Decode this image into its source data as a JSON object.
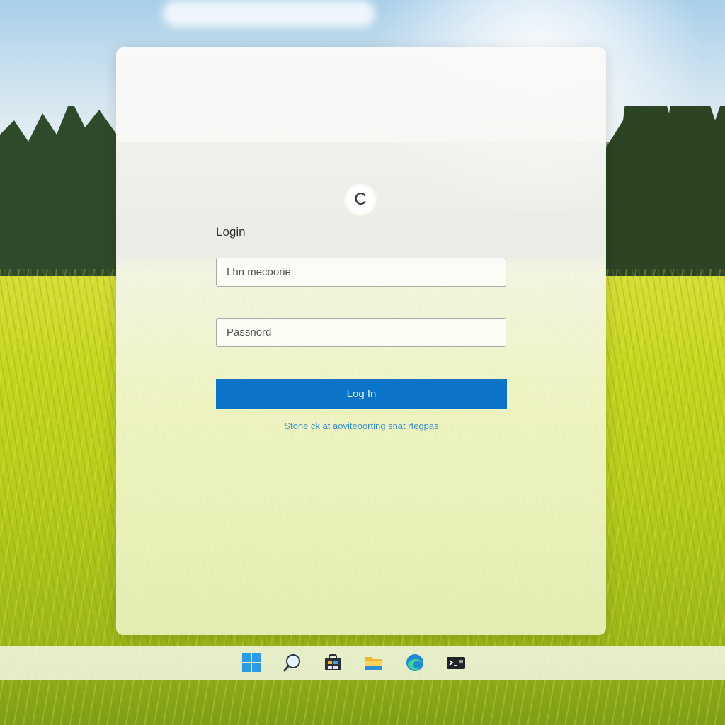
{
  "login_card": {
    "logo_letter": "C",
    "heading": "Login",
    "username_placeholder": "Lhn mecoorie",
    "password_placeholder": "Passnord",
    "login_button_label": "Log In",
    "help_link_text": "Stone ck at aoviteoorting snat rtegpas"
  },
  "taskbar": {
    "icons": [
      "windows-start-icon",
      "search-icon",
      "store-icon",
      "file-explorer-icon",
      "edge-browser-icon",
      "terminal-icon"
    ]
  },
  "colors": {
    "accent": "#0a74c9",
    "link": "#3a8fd0"
  }
}
